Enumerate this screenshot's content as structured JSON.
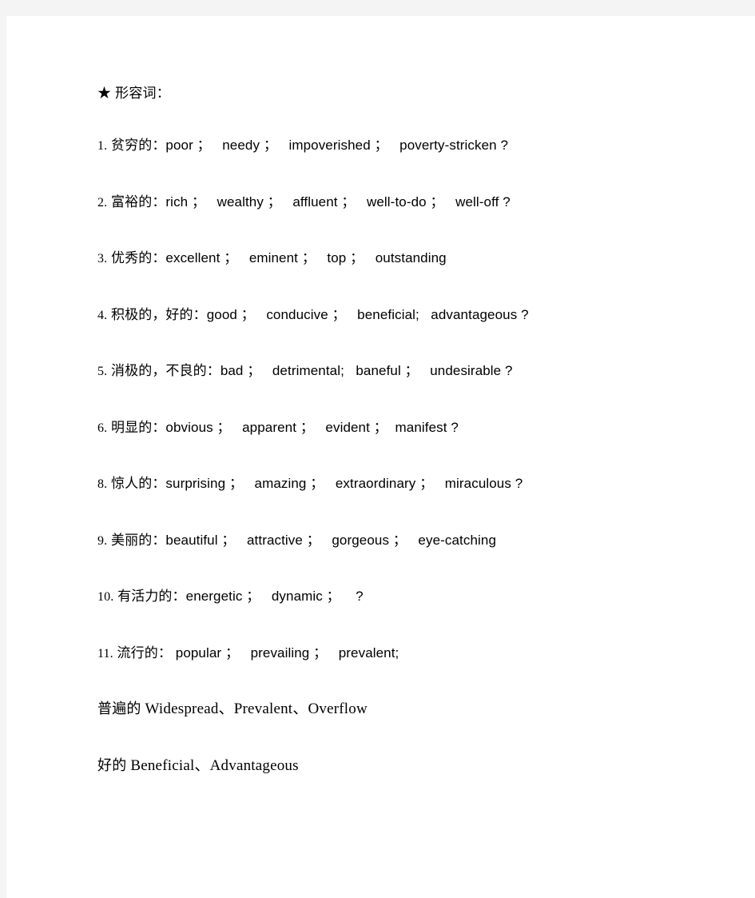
{
  "document": {
    "background_color": "#f4f4f4",
    "page_color": "#ffffff",
    "text_color": "#000000",
    "heading": "★ 形容词：",
    "vocab_items": [
      {
        "number": "1.",
        "text": " 贫穷的：poor ；   needy ；   impoverished ；   poverty-stricken ?"
      },
      {
        "number": "2.",
        "text": " 富裕的：rich ；   wealthy ；   affluent ；   well-to-do ；   well-off ?"
      },
      {
        "number": "3.",
        "text": " 优秀的：excellent ；   eminent ；   top ；   outstanding"
      },
      {
        "number": "4.",
        "text": " 积极的，好的：good ；   conducive ；   beneficial;   advantageous ?"
      },
      {
        "number": "5.",
        "text": " 消极的，不良的：bad ；   detrimental;   baneful ；   undesirable ?"
      },
      {
        "number": "6.",
        "text": " 明显的：obvious ；   apparent ；   evident ；  manifest ?"
      },
      {
        "number": "8.",
        "text": " 惊人的：surprising ；   amazing ；   extraordinary ；   miraculous ?"
      },
      {
        "number": "9.",
        "text": " 美丽的：beautiful ；   attractive ；   gorgeous ；   eye-catching"
      },
      {
        "number": "10.",
        "text": " 有活力的：energetic ；   dynamic ；    ?"
      },
      {
        "number": "11.",
        "text": " 流行的： popular ；   prevailing ；   prevalent;"
      }
    ],
    "extra_lines": [
      {
        "cn": "普遍的",
        "en": " Widespread、Prevalent、Overflow"
      },
      {
        "cn": "好的",
        "en": " Beneficial、Advantageous"
      }
    ]
  }
}
